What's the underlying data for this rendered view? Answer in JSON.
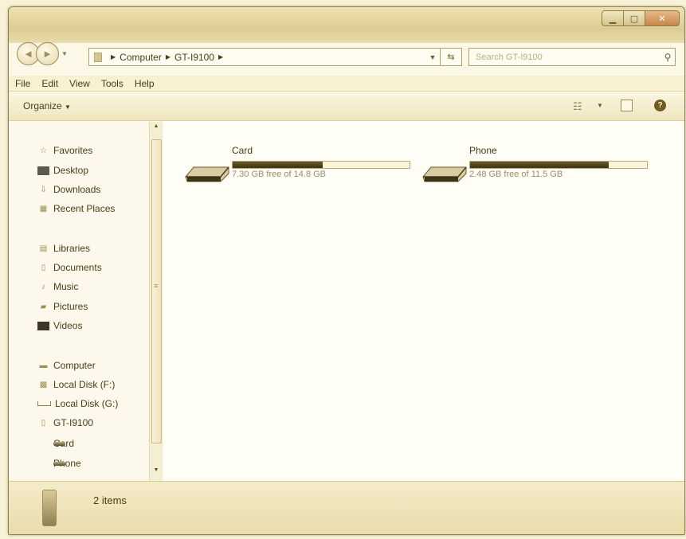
{
  "window": {
    "controls": {
      "minimize_icon": "minimize-icon",
      "maximize_icon": "maximize-icon",
      "close_icon": "close-icon"
    }
  },
  "address_bar": {
    "breadcrumb": [
      "Computer",
      "GT-I9100"
    ],
    "dropdown_icon": "chevron-down-icon",
    "refresh_icon": "refresh-icon"
  },
  "search": {
    "placeholder": "Search GT-I9100",
    "icon": "search-icon"
  },
  "menu": [
    "File",
    "Edit",
    "View",
    "Tools",
    "Help"
  ],
  "toolbar": {
    "organize_label": "Organize"
  },
  "navigation": {
    "favorites": {
      "label": "Favorites",
      "items": [
        "Desktop",
        "Downloads",
        "Recent Places"
      ]
    },
    "libraries": {
      "label": "Libraries",
      "items": [
        "Documents",
        "Music",
        "Pictures",
        "Videos"
      ]
    },
    "computer": {
      "label": "Computer",
      "items": [
        "Local Disk (F:)",
        "Local Disk (G:)",
        "GT-I9100"
      ],
      "device_items": [
        "Card",
        "Phone"
      ]
    }
  },
  "drives": [
    {
      "name": "Card",
      "info": "7.30 GB free of 14.8 GB",
      "used_fraction": 0.507
    },
    {
      "name": "Phone",
      "info": "2.48 GB free of 11.5 GB",
      "used_fraction": 0.784
    }
  ],
  "details": {
    "count": "2 items"
  },
  "colors": {
    "accent": "#5a4a20",
    "bar_fill": "#4a3c1a",
    "window_bg": "#fbf8e8"
  }
}
